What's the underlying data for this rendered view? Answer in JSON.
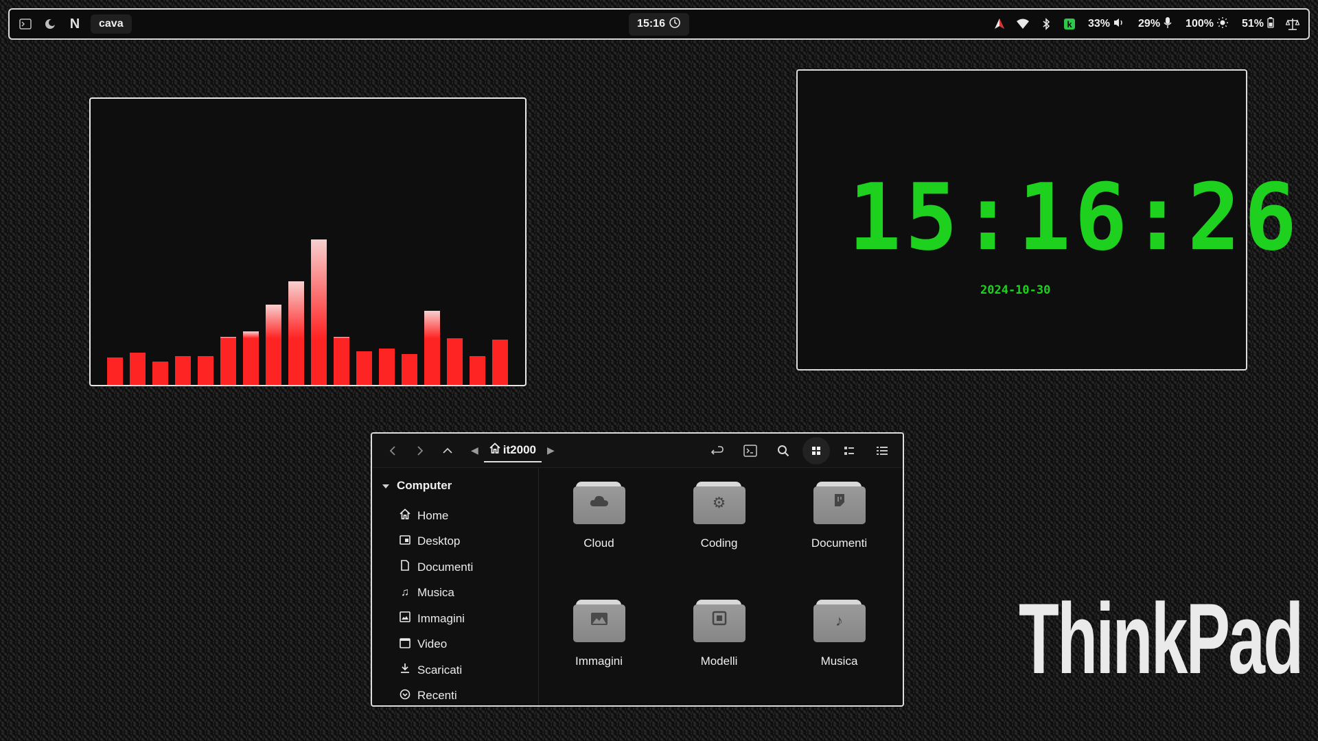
{
  "topbar": {
    "window_title": "cava",
    "clock": "15:16",
    "volume": "33%",
    "mic": "29%",
    "brightness": "100%",
    "battery": "51%"
  },
  "cava": {
    "bar_color": "#ff2424",
    "peak_color": "#f8d0d0",
    "levels": [
      0.19,
      0.22,
      0.16,
      0.2,
      0.2,
      0.33,
      0.37,
      0.55,
      0.71,
      1.0,
      0.33,
      0.23,
      0.25,
      0.21,
      0.51,
      0.32,
      0.2,
      0.31
    ]
  },
  "clock_widget": {
    "time": "15:16:26",
    "date": "2024-10-30",
    "color": "#1fd11f"
  },
  "file_manager": {
    "path_label": "it2000",
    "sidebar_section": "Computer",
    "sidebar_items": [
      {
        "label": "Home",
        "icon": "home-icon"
      },
      {
        "label": "Desktop",
        "icon": "desktop-icon"
      },
      {
        "label": "Documenti",
        "icon": "document-icon"
      },
      {
        "label": "Musica",
        "icon": "music-icon"
      },
      {
        "label": "Immagini",
        "icon": "image-icon"
      },
      {
        "label": "Video",
        "icon": "video-icon"
      },
      {
        "label": "Scaricati",
        "icon": "download-icon"
      },
      {
        "label": "Recenti",
        "icon": "recent-icon"
      }
    ],
    "folders": [
      {
        "label": "Cloud",
        "icon": "cloud-icon"
      },
      {
        "label": "Coding",
        "icon": "gear-icon"
      },
      {
        "label": "Documenti",
        "icon": "document-icon"
      },
      {
        "label": "Immagini",
        "icon": "image-icon"
      },
      {
        "label": "Modelli",
        "icon": "template-icon"
      },
      {
        "label": "Musica",
        "icon": "music-icon"
      }
    ]
  },
  "wallpaper": {
    "brand": "ThinkPad"
  }
}
